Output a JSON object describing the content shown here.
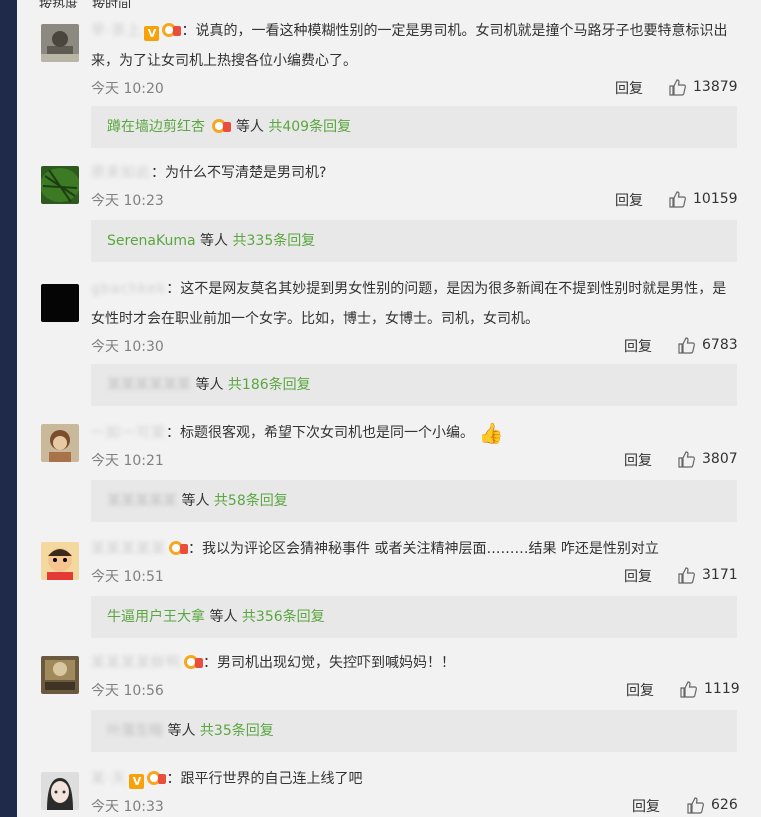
{
  "top_tabs": [
    "按热度",
    "按时间"
  ],
  "reply_label": "回复",
  "comments": [
    {
      "user": "早·茶上",
      "text": "：说真的，一看这种模糊性别的一定是男司机。女司机就是撞个马路牙子也要特意标识出来，为了让女司机上热搜各位小编费心了。",
      "time": "今天 10:20",
      "likes": "13879",
      "replies": {
        "user": "蹲在墙边剪红杏",
        "others": "等人",
        "count": "共409条回复"
      }
    },
    {
      "user": "原来如此",
      "text": "：为什么不写清楚是男司机?",
      "time": "今天 10:23",
      "likes": "10159",
      "replies": {
        "user": "SerenaKuma",
        "others": "等人",
        "count": "共335条回复"
      }
    },
    {
      "user": "gbachkek",
      "text": "：这不是网友莫名其妙提到男女性别的问题，是因为很多新闻在不提到性别时就是男性，是女性时才会在职业前加一个女字。比如，博士，女博士。司机，女司机。",
      "time": "今天 10:30",
      "likes": "6783",
      "replies": {
        "user": "某某某某某某",
        "others": "等人",
        "count": "共186条回复"
      }
    },
    {
      "user": "一如一可爱",
      "text": "：标题很客观，希望下次女司机也是同一个小编。",
      "time": "今天 10:21",
      "likes": "3807",
      "replies": {
        "user": "某某某某某",
        "others": "等人",
        "count": "共58条回复"
      }
    },
    {
      "user": "某某某某某",
      "text": "：我以为评论区会猜神秘事件 或者关注精神层面………结果 咋还是性别对立",
      "time": "今天 10:51",
      "likes": "3171",
      "replies": {
        "user": "牛逼用户王大拿",
        "others": "等人",
        "count": "共356条回复"
      }
    },
    {
      "user": "某某某某鲜鸭",
      "text": "：男司机出现幻觉，失控吓到喊妈妈！！",
      "time": "今天 10:56",
      "likes": "1119",
      "replies": {
        "user": "叶落生暗",
        "others": "等人",
        "count": "共35条回复"
      }
    },
    {
      "user": "某·天",
      "text": "：跟平行世界的自己连上线了吧",
      "time": "今天 10:33",
      "likes": "626"
    }
  ]
}
